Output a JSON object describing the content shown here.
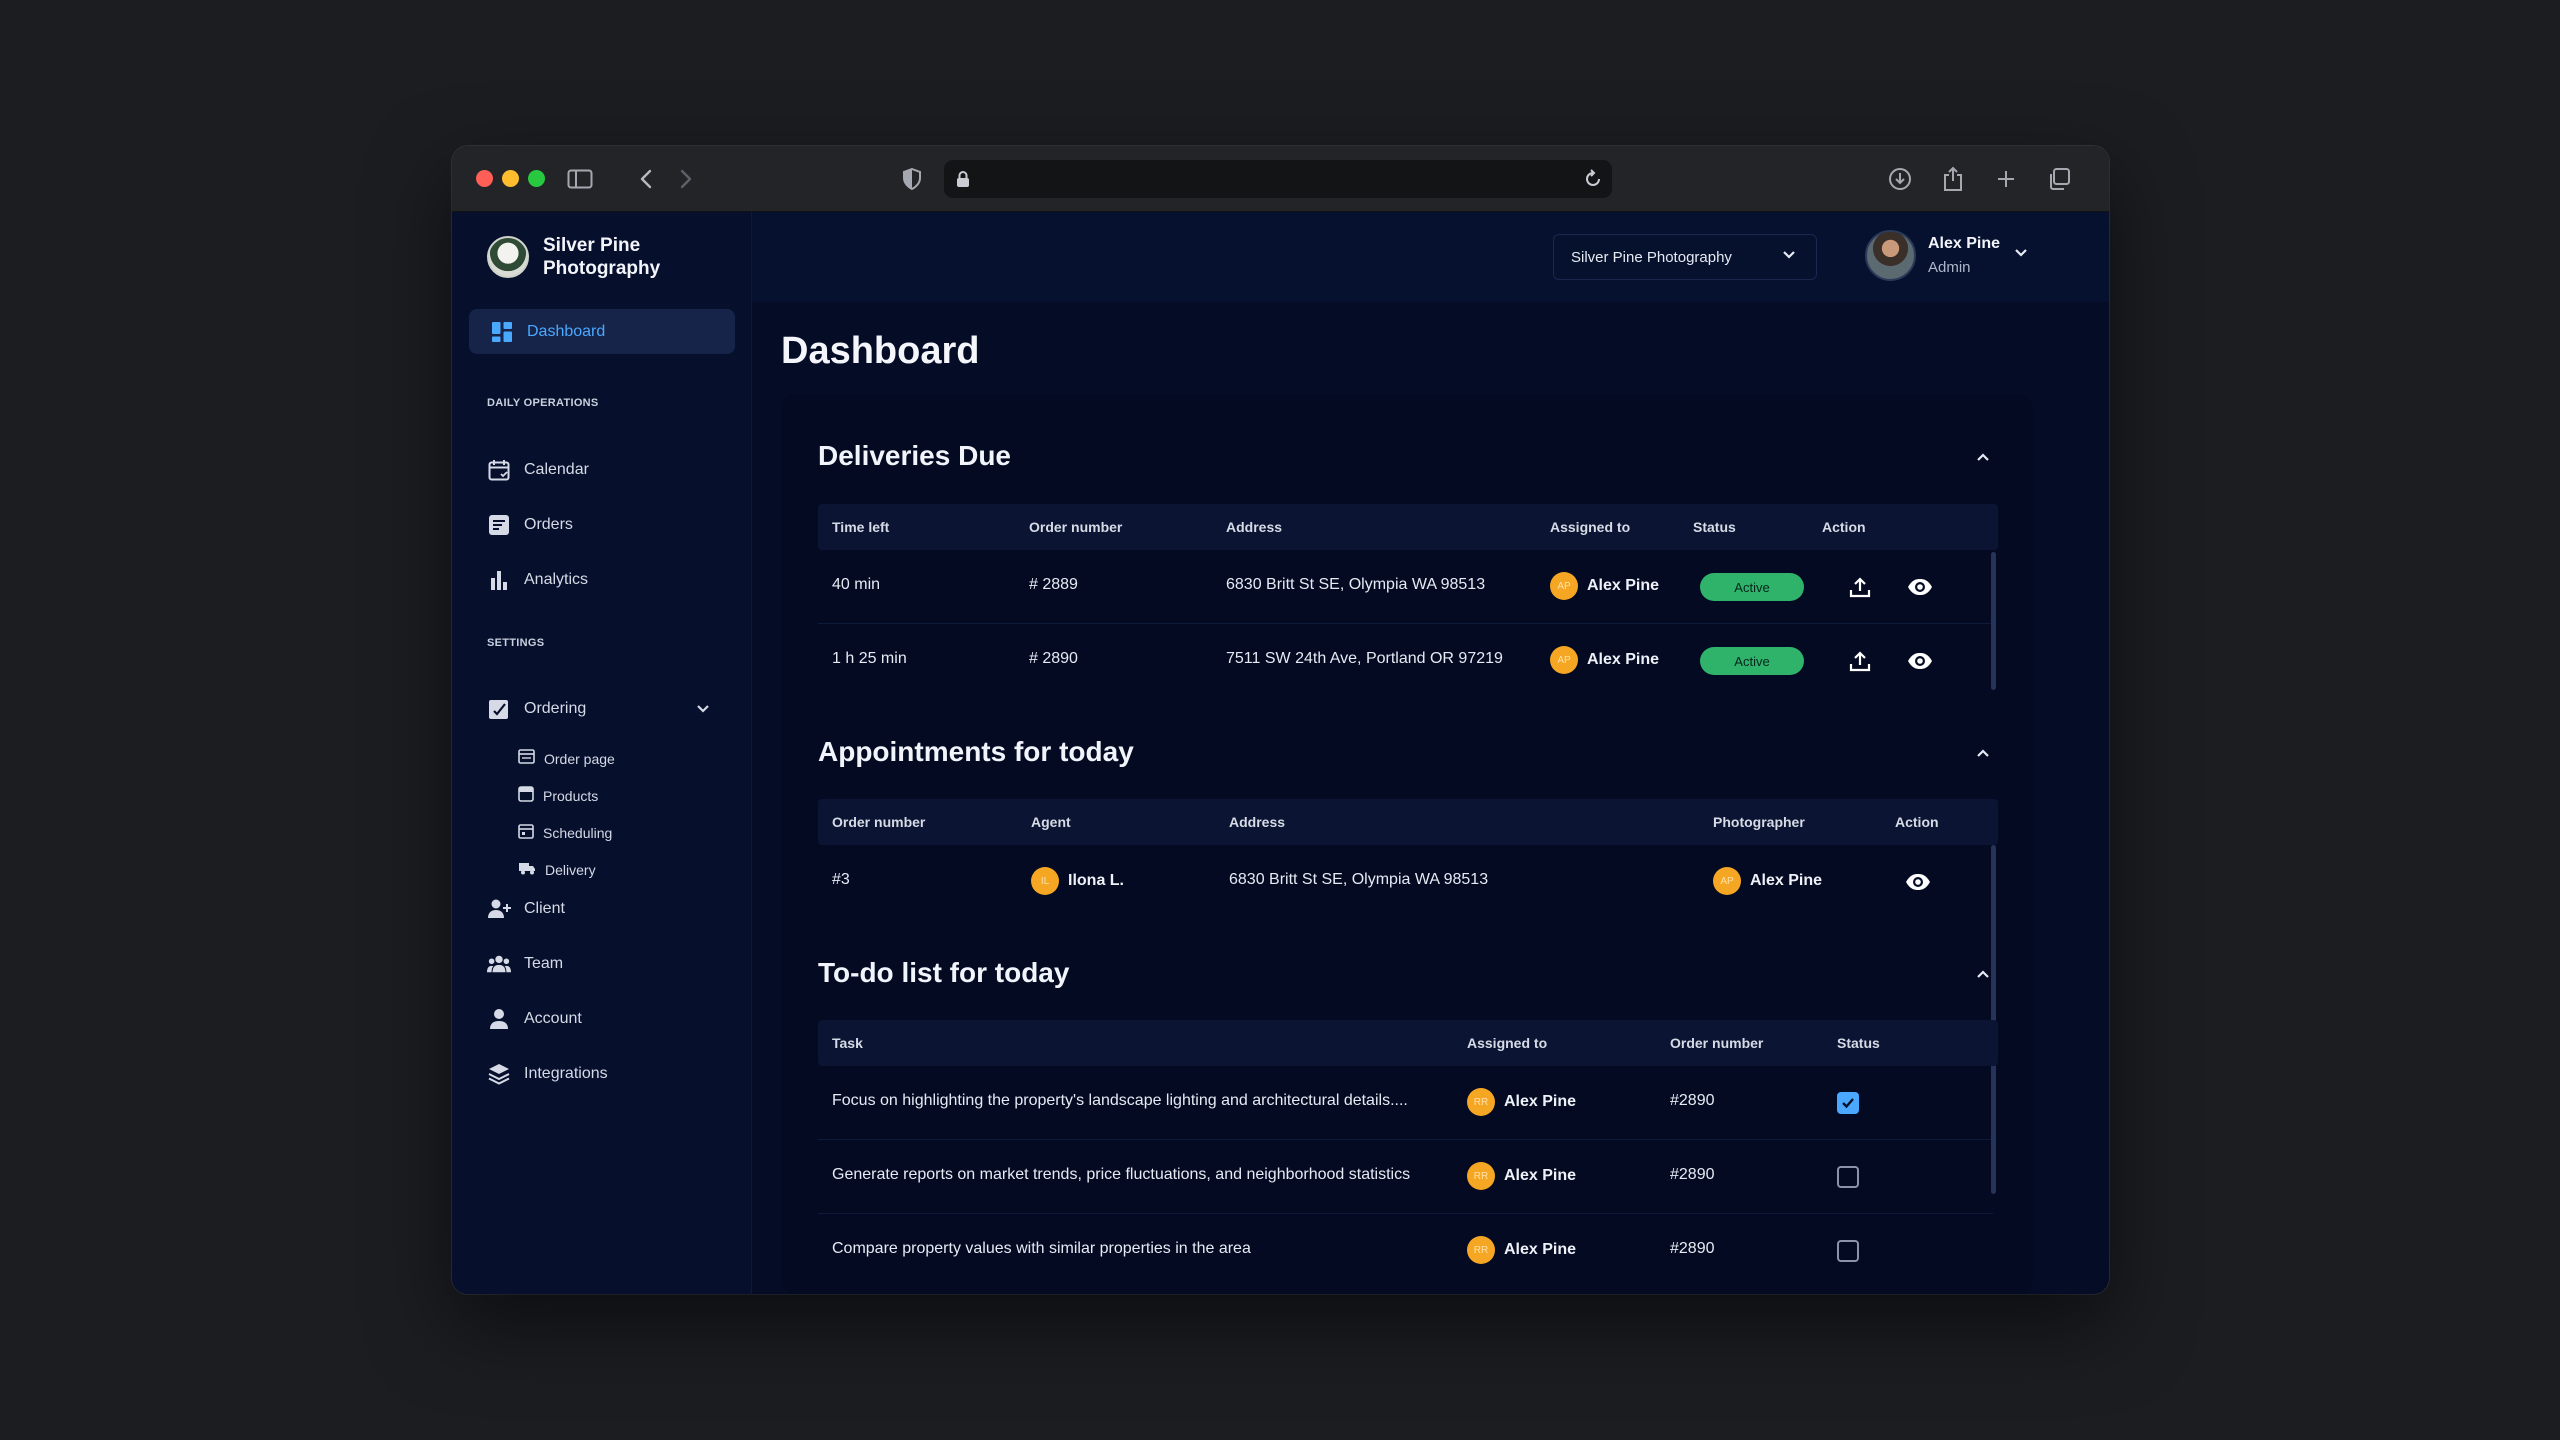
{
  "browser": {
    "url": ""
  },
  "sidebar": {
    "brand": "Silver Pine Photography",
    "active_item": "Dashboard",
    "sections": {
      "daily": "DAILY OPERATIONS",
      "settings": "SETTINGS"
    },
    "daily_items": [
      "Calendar",
      "Orders",
      "Analytics"
    ],
    "ordering": {
      "label": "Ordering",
      "subitems": [
        "Order page",
        "Products",
        "Scheduling",
        "Delivery"
      ]
    },
    "other_items": [
      "Client",
      "Team",
      "Account",
      "Integrations"
    ]
  },
  "header": {
    "workspace": "Silver Pine Photography",
    "user_name": "Alex Pine",
    "user_role": "Admin"
  },
  "page_title": "Dashboard",
  "deliveries": {
    "title": "Deliveries Due",
    "columns": [
      "Time left",
      "Order number",
      "Address",
      "Assigned to",
      "Status",
      "Action"
    ],
    "rows": [
      {
        "time_left": "40 min",
        "order": "# 2889",
        "address": "6830 Britt St SE, Olympia WA 98513",
        "assignee_initials": "AP",
        "assignee": "Alex Pine",
        "status": "Active"
      },
      {
        "time_left": "1 h 25 min",
        "order": "# 2890",
        "address": "7511 SW 24th Ave, Portland OR 97219",
        "assignee_initials": "AP",
        "assignee": "Alex Pine",
        "status": "Active"
      }
    ]
  },
  "appointments": {
    "title": "Appointments for today",
    "columns": [
      "Order number",
      "Agent",
      "Address",
      "Photographer",
      "Action"
    ],
    "rows": [
      {
        "order": "#3",
        "agent_initials": "IL",
        "agent": "Ilona L.",
        "address": "6830 Britt St SE, Olympia WA 98513",
        "photographer_initials": "AP",
        "photographer": "Alex Pine"
      }
    ]
  },
  "todo": {
    "title": "To-do list for today",
    "columns": [
      "Task",
      "Assigned to",
      "Order number",
      "Status"
    ],
    "rows": [
      {
        "task": "Focus on highlighting the property's landscape lighting and architectural details....",
        "assignee_initials": "RR",
        "assignee": "Alex Pine",
        "order": "#2890",
        "done": true
      },
      {
        "task": "Generate reports on market trends, price fluctuations, and neighborhood statistics",
        "assignee_initials": "RR",
        "assignee": "Alex Pine",
        "order": "#2890",
        "done": false
      },
      {
        "task": "Compare property values with similar properties in the area",
        "assignee_initials": "RR",
        "assignee": "Alex Pine",
        "order": "#2890",
        "done": false
      }
    ]
  },
  "colors": {
    "accent": "#4aa8ff",
    "active_badge": "#2fb36b",
    "avatar": "#f5a623"
  },
  "icons": [
    "sidebar-toggle-icon",
    "back-icon",
    "forward-icon",
    "shield-icon",
    "lock-icon",
    "reload-icon",
    "download-icon",
    "share-icon",
    "plus-icon",
    "tabs-icon",
    "dashboard-icon",
    "calendar-icon",
    "orders-icon",
    "analytics-icon",
    "ordering-icon",
    "chevron-down-icon",
    "client-icon",
    "team-icon",
    "account-icon",
    "integrations-icon",
    "upload-icon",
    "eye-icon",
    "chevron-up-icon"
  ]
}
